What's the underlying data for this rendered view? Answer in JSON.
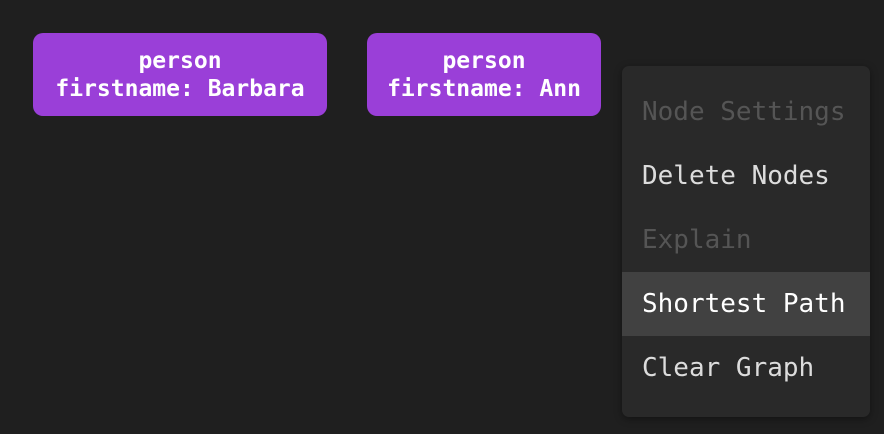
{
  "nodes": [
    {
      "label": "person",
      "property": "firstname: Barbara"
    },
    {
      "label": "person",
      "property": "firstname: Ann"
    }
  ],
  "context_menu": {
    "items": [
      {
        "label": "Node Settings",
        "state": "disabled"
      },
      {
        "label": "Delete Nodes",
        "state": "enabled"
      },
      {
        "label": "Explain",
        "state": "disabled"
      },
      {
        "label": "Shortest Path",
        "state": "hovered"
      },
      {
        "label": "Clear Graph",
        "state": "enabled"
      }
    ]
  },
  "colors": {
    "node": "#9a3fd8",
    "background": "#1f1f1f",
    "menu": "#292929",
    "menu_hover": "#414141"
  }
}
